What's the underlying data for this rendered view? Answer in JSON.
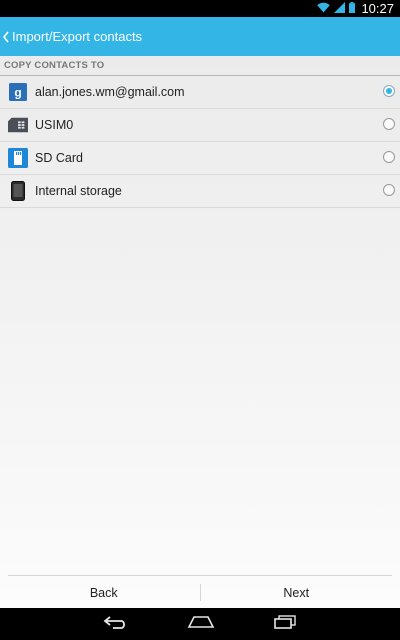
{
  "status_bar": {
    "time": "10:27",
    "icons": [
      "wifi-icon",
      "signal-icon",
      "battery-icon"
    ]
  },
  "action_bar": {
    "title": "Import/Export contacts",
    "background_color": "#33b5e5"
  },
  "section": {
    "header": "COPY CONTACTS TO"
  },
  "destinations": [
    {
      "label": "alan.jones.wm@gmail.com",
      "icon": "google-account-icon",
      "selected": true
    },
    {
      "label": "USIM0",
      "icon": "sim-card-icon",
      "selected": false
    },
    {
      "label": "SD Card",
      "icon": "sd-card-icon",
      "selected": false
    },
    {
      "label": "Internal storage",
      "icon": "phone-storage-icon",
      "selected": false
    }
  ],
  "buttons": {
    "back_label": "Back",
    "next_label": "Next"
  },
  "nav_bar": {
    "icons": [
      "back-nav-icon",
      "home-nav-icon",
      "recents-nav-icon"
    ]
  },
  "accent_color": "#33b5e5"
}
